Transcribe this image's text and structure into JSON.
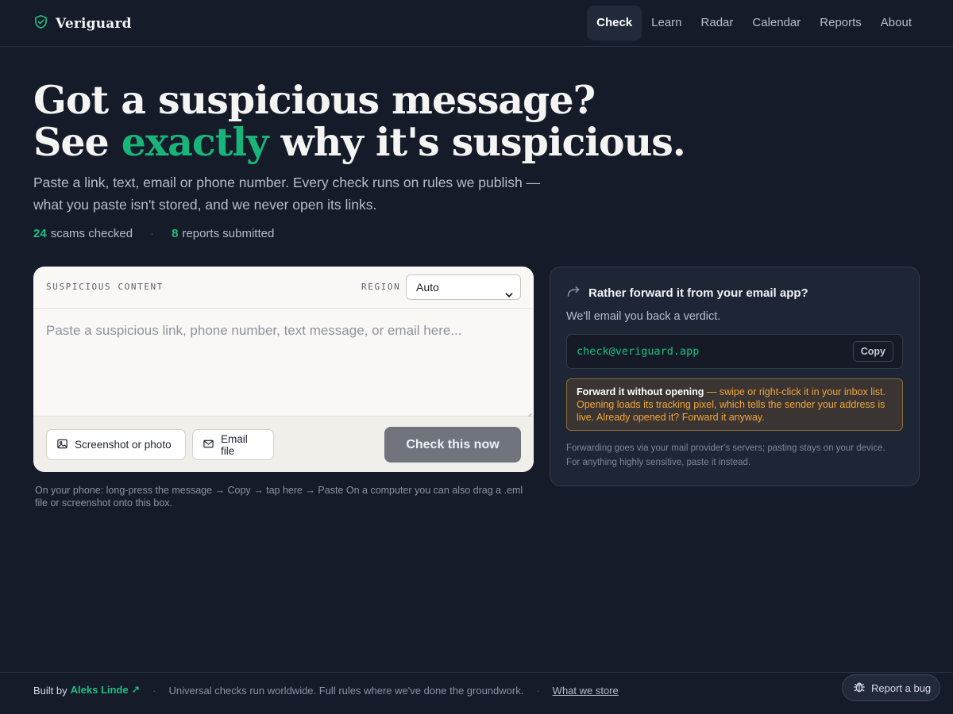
{
  "brand": {
    "name": "Veriguard",
    "icon": "shield-check-icon"
  },
  "nav": [
    {
      "label": "Check",
      "active": true
    },
    {
      "label": "Learn",
      "active": false
    },
    {
      "label": "Radar",
      "active": false
    },
    {
      "label": "Calendar",
      "active": false
    },
    {
      "label": "Reports",
      "active": false
    },
    {
      "label": "About",
      "active": false
    }
  ],
  "hero": {
    "line1": "Got a suspicious message?",
    "line2_pre": "See ",
    "line2_accent": "exactly",
    "line2_post": " why it's suspicious.",
    "subtitle": "Paste a link, text, email or phone number. Every check runs on rules we publish — what you paste isn't stored, and we never open its links."
  },
  "stats": {
    "scams_count": "24",
    "scams_label": "scams checked",
    "reports_count": "8",
    "reports_label": "reports submitted"
  },
  "checker": {
    "label": "SUSPICIOUS CONTENT",
    "region_label": "REGION",
    "region_value": "Auto",
    "placeholder": "Paste a suspicious link, phone number, text message, or email here...",
    "screenshot_button": "Screenshot or photo",
    "email_button": "Email file",
    "check_button": "Check this now",
    "hint": "On your phone: long-press the message → Copy → tap here → Paste On a computer you can also drag a .eml file or screenshot onto this box."
  },
  "forward": {
    "title": "Rather forward it from your email app?",
    "description": "We'll email you back a verdict.",
    "address": "check@veriguard.app",
    "copy_button": "Copy",
    "warning_bold": "Forward it without opening",
    "warning_text": " — swipe or right-click it in your inbox list. Opening loads its tracking pixel, which tells the sender your address is live. Already opened it? Forward it anyway.",
    "note": "Forwarding goes via your mail provider's servers; pasting stays on your device. For anything highly sensitive, paste it instead."
  },
  "footer": {
    "built_by": "Built by",
    "author": "Aleks Linde ↗",
    "tagline": "Universal checks run worldwide. Full rules where we've done the groundwork.",
    "store_link": "What we store",
    "bug_button": "Report a bug"
  },
  "colors": {
    "accent": "#18b57a",
    "background": "#161b29",
    "warning": "#f3a73a"
  }
}
